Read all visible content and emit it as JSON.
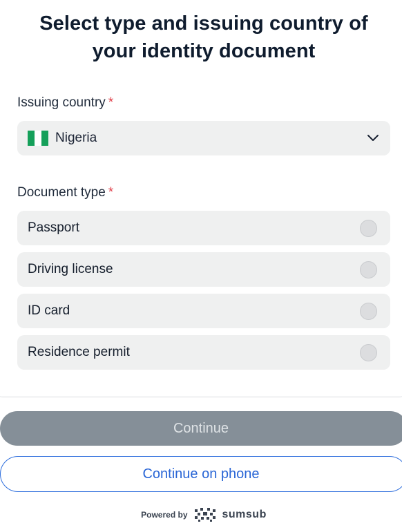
{
  "header": {
    "title_line1": "Select type and issuing country of",
    "title_line2": "your identity document"
  },
  "country": {
    "label": "Issuing country",
    "required_mark": "*",
    "selected": "Nigeria",
    "flag_colors": [
      "#15a05a",
      "#ffffff",
      "#15a05a"
    ]
  },
  "document": {
    "label": "Document type",
    "required_mark": "*",
    "options": [
      {
        "label": "Passport",
        "selected": false
      },
      {
        "label": "Driving license",
        "selected": false
      },
      {
        "label": "ID card",
        "selected": false
      },
      {
        "label": "Residence permit",
        "selected": false
      }
    ]
  },
  "actions": {
    "continue_label": "Continue",
    "continue_enabled": false,
    "continue_phone_label": "Continue on phone"
  },
  "footer": {
    "powered_by": "Powered by",
    "brand": "sumsub",
    "brand_icon": "sumsub-logo-icon"
  },
  "colors": {
    "accent": "#2a66d6",
    "required": "#e0404a",
    "disabled_button": "#858f98"
  }
}
